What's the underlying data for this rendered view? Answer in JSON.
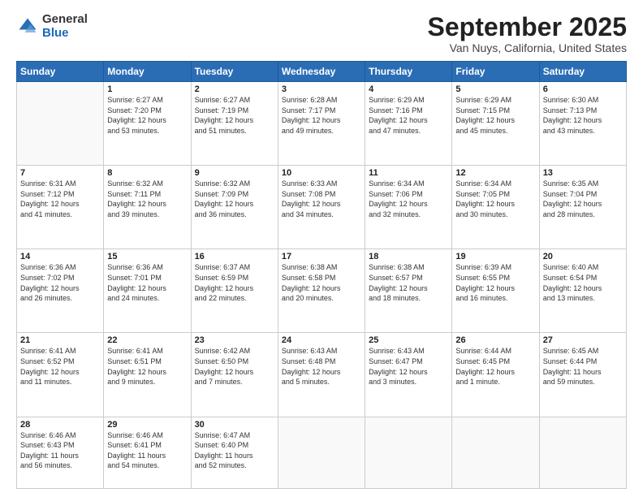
{
  "logo": {
    "general": "General",
    "blue": "Blue"
  },
  "header": {
    "month": "September 2025",
    "location": "Van Nuys, California, United States"
  },
  "weekdays": [
    "Sunday",
    "Monday",
    "Tuesday",
    "Wednesday",
    "Thursday",
    "Friday",
    "Saturday"
  ],
  "weeks": [
    [
      {
        "day": "",
        "content": ""
      },
      {
        "day": "1",
        "content": "Sunrise: 6:27 AM\nSunset: 7:20 PM\nDaylight: 12 hours\nand 53 minutes."
      },
      {
        "day": "2",
        "content": "Sunrise: 6:27 AM\nSunset: 7:19 PM\nDaylight: 12 hours\nand 51 minutes."
      },
      {
        "day": "3",
        "content": "Sunrise: 6:28 AM\nSunset: 7:17 PM\nDaylight: 12 hours\nand 49 minutes."
      },
      {
        "day": "4",
        "content": "Sunrise: 6:29 AM\nSunset: 7:16 PM\nDaylight: 12 hours\nand 47 minutes."
      },
      {
        "day": "5",
        "content": "Sunrise: 6:29 AM\nSunset: 7:15 PM\nDaylight: 12 hours\nand 45 minutes."
      },
      {
        "day": "6",
        "content": "Sunrise: 6:30 AM\nSunset: 7:13 PM\nDaylight: 12 hours\nand 43 minutes."
      }
    ],
    [
      {
        "day": "7",
        "content": "Sunrise: 6:31 AM\nSunset: 7:12 PM\nDaylight: 12 hours\nand 41 minutes."
      },
      {
        "day": "8",
        "content": "Sunrise: 6:32 AM\nSunset: 7:11 PM\nDaylight: 12 hours\nand 39 minutes."
      },
      {
        "day": "9",
        "content": "Sunrise: 6:32 AM\nSunset: 7:09 PM\nDaylight: 12 hours\nand 36 minutes."
      },
      {
        "day": "10",
        "content": "Sunrise: 6:33 AM\nSunset: 7:08 PM\nDaylight: 12 hours\nand 34 minutes."
      },
      {
        "day": "11",
        "content": "Sunrise: 6:34 AM\nSunset: 7:06 PM\nDaylight: 12 hours\nand 32 minutes."
      },
      {
        "day": "12",
        "content": "Sunrise: 6:34 AM\nSunset: 7:05 PM\nDaylight: 12 hours\nand 30 minutes."
      },
      {
        "day": "13",
        "content": "Sunrise: 6:35 AM\nSunset: 7:04 PM\nDaylight: 12 hours\nand 28 minutes."
      }
    ],
    [
      {
        "day": "14",
        "content": "Sunrise: 6:36 AM\nSunset: 7:02 PM\nDaylight: 12 hours\nand 26 minutes."
      },
      {
        "day": "15",
        "content": "Sunrise: 6:36 AM\nSunset: 7:01 PM\nDaylight: 12 hours\nand 24 minutes."
      },
      {
        "day": "16",
        "content": "Sunrise: 6:37 AM\nSunset: 6:59 PM\nDaylight: 12 hours\nand 22 minutes."
      },
      {
        "day": "17",
        "content": "Sunrise: 6:38 AM\nSunset: 6:58 PM\nDaylight: 12 hours\nand 20 minutes."
      },
      {
        "day": "18",
        "content": "Sunrise: 6:38 AM\nSunset: 6:57 PM\nDaylight: 12 hours\nand 18 minutes."
      },
      {
        "day": "19",
        "content": "Sunrise: 6:39 AM\nSunset: 6:55 PM\nDaylight: 12 hours\nand 16 minutes."
      },
      {
        "day": "20",
        "content": "Sunrise: 6:40 AM\nSunset: 6:54 PM\nDaylight: 12 hours\nand 13 minutes."
      }
    ],
    [
      {
        "day": "21",
        "content": "Sunrise: 6:41 AM\nSunset: 6:52 PM\nDaylight: 12 hours\nand 11 minutes."
      },
      {
        "day": "22",
        "content": "Sunrise: 6:41 AM\nSunset: 6:51 PM\nDaylight: 12 hours\nand 9 minutes."
      },
      {
        "day": "23",
        "content": "Sunrise: 6:42 AM\nSunset: 6:50 PM\nDaylight: 12 hours\nand 7 minutes."
      },
      {
        "day": "24",
        "content": "Sunrise: 6:43 AM\nSunset: 6:48 PM\nDaylight: 12 hours\nand 5 minutes."
      },
      {
        "day": "25",
        "content": "Sunrise: 6:43 AM\nSunset: 6:47 PM\nDaylight: 12 hours\nand 3 minutes."
      },
      {
        "day": "26",
        "content": "Sunrise: 6:44 AM\nSunset: 6:45 PM\nDaylight: 12 hours\nand 1 minute."
      },
      {
        "day": "27",
        "content": "Sunrise: 6:45 AM\nSunset: 6:44 PM\nDaylight: 11 hours\nand 59 minutes."
      }
    ],
    [
      {
        "day": "28",
        "content": "Sunrise: 6:46 AM\nSunset: 6:43 PM\nDaylight: 11 hours\nand 56 minutes."
      },
      {
        "day": "29",
        "content": "Sunrise: 6:46 AM\nSunset: 6:41 PM\nDaylight: 11 hours\nand 54 minutes."
      },
      {
        "day": "30",
        "content": "Sunrise: 6:47 AM\nSunset: 6:40 PM\nDaylight: 11 hours\nand 52 minutes."
      },
      {
        "day": "",
        "content": ""
      },
      {
        "day": "",
        "content": ""
      },
      {
        "day": "",
        "content": ""
      },
      {
        "day": "",
        "content": ""
      }
    ]
  ]
}
